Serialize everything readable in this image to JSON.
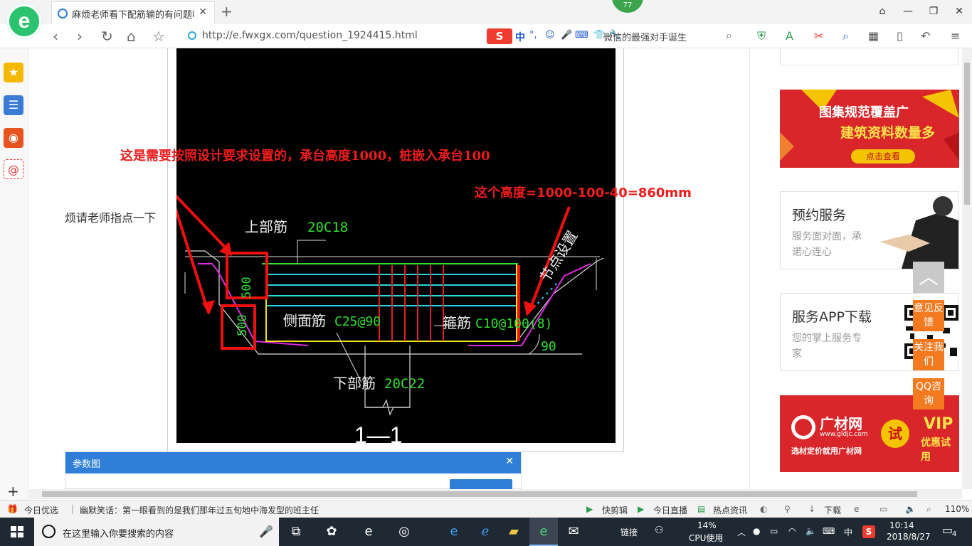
{
  "browser": {
    "tab_title": "麻烦老师看下配筋输的有问题吗_",
    "tab_close": "✕",
    "new_tab": "+",
    "badge": "77",
    "url": "http://e.fwxgx.com/question_1924415.html",
    "search_hint": "微信的最强对手诞生",
    "ime": {
      "logo": "S",
      "label": "中",
      "sym1": "°,",
      "sym2": "☺"
    }
  },
  "page": {
    "question_text": "烦请老师指点一下",
    "annotation_red_1": "这是需要按照设计要求设置的，承台高度1000，桩嵌入承台100",
    "annotation_red_2": "这个高度=1000-100-40=860mm",
    "cad": {
      "top_rebar_label": "上部筋",
      "top_rebar_spec": "20C18",
      "side_rebar_label": "侧面筋",
      "side_rebar_spec": "C25@90",
      "stirrup_label": "箍筋",
      "stirrup_spec": "C10@100(8)",
      "bottom_rebar_label": "下部筋",
      "bottom_rebar_spec": "20C22",
      "node_label": "节点设置",
      "dim_500_a": "500",
      "dim_500_b": "500",
      "angle": "90",
      "section": "1—1"
    },
    "params_panel": {
      "title": "参数图",
      "close": "✕"
    }
  },
  "sidebar_right": {
    "banner1_line1": "图集规范覆盖广",
    "banner1_line2": "建筑资料数量多",
    "banner1_btn": "点击查看",
    "card1_title": "预约服务",
    "card1_sub1": "服务面对面，承",
    "card1_sub2": "诺心连心",
    "card2_title": "服务APP下载",
    "card2_sub1": "您的掌上服务专",
    "card2_sub2": "家",
    "banner2_brand": "广材网",
    "banner2_url": "www.gldjc.com",
    "banner2_slogan": "选材定价就用广材网",
    "banner2_try": "试",
    "banner2_vip1": "VIP",
    "banner2_vip2": "优惠试用",
    "float_feedback": "意见反馈",
    "float_follow": "关注我们",
    "float_qq": "QQ咨询"
  },
  "statusbar": {
    "today_pick": "今日优选",
    "news": "幽默笑话：第一眼看到的是我们那年过五旬地中海发型的班主任",
    "quick_clip": "快剪辑",
    "today_live": "今日直播",
    "hot_news": "热点资讯",
    "download": "下载",
    "zoom": "110%"
  },
  "taskbar": {
    "search_placeholder": "在这里输入你要搜索的内容",
    "link": "链接",
    "cpu_percent": "14%",
    "cpu_label": "CPU使用",
    "ime": "中",
    "time": "10:14",
    "date": "2018/8/27",
    "notifications": "4"
  }
}
